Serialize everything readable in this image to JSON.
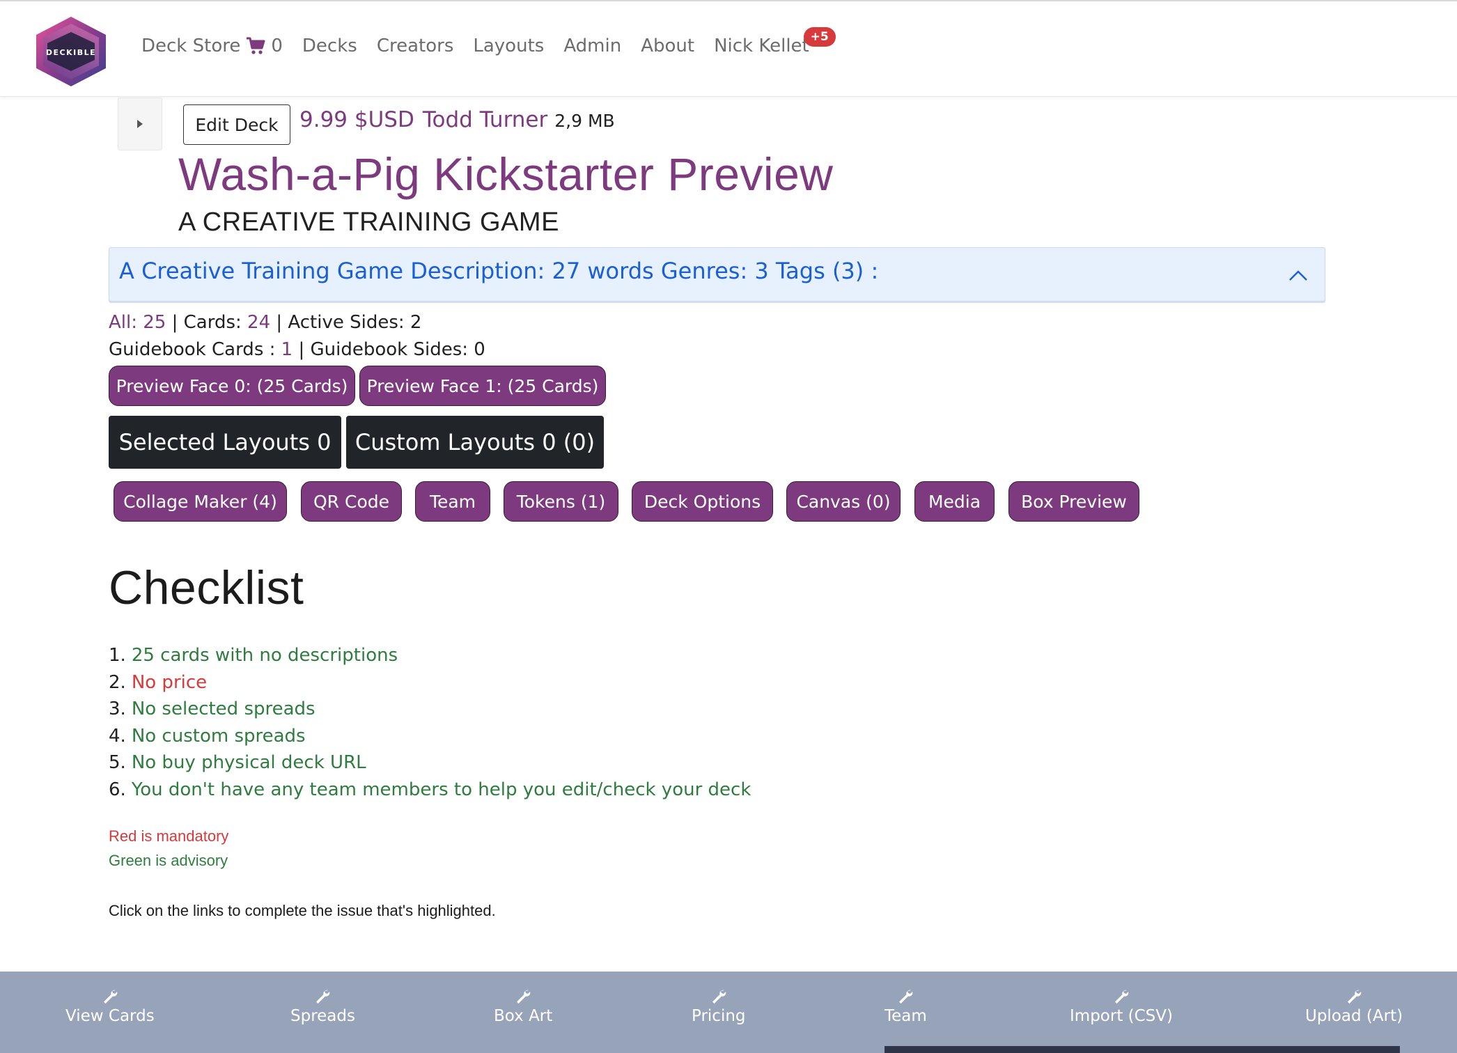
{
  "nav": {
    "brand": "DECKIBLE",
    "deck_store": "Deck Store",
    "cart_count": "0",
    "decks": "Decks",
    "creators": "Creators",
    "layouts": "Layouts",
    "admin": "Admin",
    "about": "About",
    "user": "Nick Kellet",
    "badge": "+5"
  },
  "deck": {
    "edit_label": "Edit Deck",
    "price": "9.99 $USD",
    "author": "Todd Turner",
    "size": "2,9 MB",
    "title": "Wash-a-Pig Kickstarter Preview",
    "subtitle": "A CREATIVE TRAINING GAME"
  },
  "accordion": {
    "text": "A Creative Training Game Description: 27 words Genres: 3 Tags (3) :"
  },
  "stats": {
    "all_label": "All:",
    "all_value": "25",
    "sep1": " | Cards: ",
    "cards_value": "24",
    "active_sides": " | Active Sides: 2",
    "guidebook_label": "Guidebook Cards : ",
    "guidebook_value": "1",
    "guidebook_sides": " | Guidebook Sides: 0"
  },
  "preview_buttons": [
    "Preview Face 0: (25 Cards)",
    "Preview Face 1: (25 Cards)"
  ],
  "layout_buttons": {
    "selected": "Selected Layouts 0",
    "custom": "Custom Layouts 0 (0)"
  },
  "tool_buttons": [
    "Collage Maker (4)",
    "QR Code",
    "Team",
    "Tokens (1)",
    "Deck Options",
    "Canvas (0)",
    "Media",
    "Box Preview"
  ],
  "checklist": {
    "title": "Checklist",
    "items": [
      {
        "num": "1.",
        "text": "25 cards with no descriptions",
        "status": "advisory"
      },
      {
        "num": "2.",
        "text": "No price",
        "status": "mandatory"
      },
      {
        "num": "3.",
        "text": "No selected spreads",
        "status": "advisory"
      },
      {
        "num": "4.",
        "text": "No custom spreads",
        "status": "advisory"
      },
      {
        "num": "5.",
        "text": "No buy physical deck URL",
        "status": "advisory"
      },
      {
        "num": "6.",
        "text": "You don't have any team members to help you edit/check your deck",
        "status": "advisory"
      }
    ],
    "legend_red": "Red is mandatory",
    "legend_green": "Green is advisory",
    "hint": "Click on the links to complete the issue that's highlighted."
  },
  "bottom_tools": [
    {
      "label": "View Cards",
      "icon": "wrench-icon"
    },
    {
      "label": "Spreads",
      "icon": "wrench-icon"
    },
    {
      "label": "Box Art",
      "icon": "wrench-icon"
    },
    {
      "label": "Pricing",
      "icon": "wrench-icon"
    },
    {
      "label": "Team",
      "icon": "wrench-icon"
    },
    {
      "label": "Import (CSV)",
      "icon": "wrench-icon"
    },
    {
      "label": "Upload (Art)",
      "icon": "wrench-icon"
    }
  ],
  "colors": {
    "brand_purple": "#7d3a7f",
    "dark_button": "#212529",
    "accordion_bg": "#e7f0fd",
    "link_blue": "#1a5fd6",
    "advisory_green": "#2e7d3f",
    "mandatory_red": "#d63a3a",
    "bottom_bar": "#96a3b8"
  }
}
